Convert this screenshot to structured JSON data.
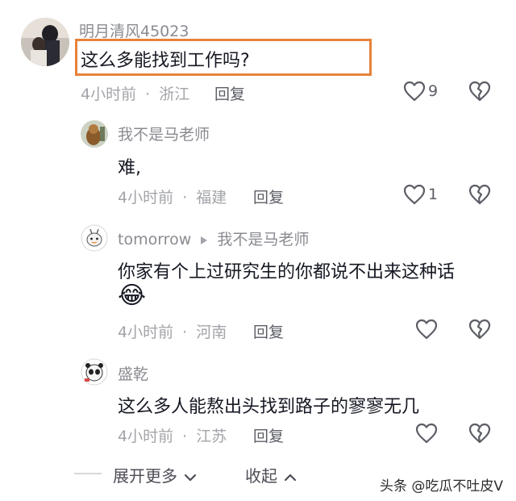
{
  "comments": [
    {
      "username": "明月清风45023",
      "text": "这么多能找到工作吗?",
      "time": "4小时前",
      "location": "浙江",
      "reply_label": "回复",
      "likes": "9",
      "highlighted": true
    },
    {
      "username": "我不是马老师",
      "text": "难,",
      "time": "4小时前",
      "location": "福建",
      "reply_label": "回复",
      "likes": "1"
    },
    {
      "username": "tomorrow",
      "reply_to": "我不是马老师",
      "text": "你家有个上过研究生的你都说不出来这种话",
      "emoji": "😂",
      "time": "4小时前",
      "location": "河南",
      "reply_label": "回复",
      "likes": ""
    },
    {
      "username": "盛乾",
      "text": "这么多人能熬出头找到路子的寥寥无几",
      "time": "4小时前",
      "location": "江苏",
      "reply_label": "回复",
      "likes": ""
    }
  ],
  "footer": {
    "expand_label": "展开更多",
    "collapse_label": "收起"
  },
  "watermark": "头条 @吃瓜不吐皮V",
  "separator": "·",
  "colors": {
    "highlight_border": "#e8823a",
    "text_primary": "#161823",
    "text_secondary": "#a3a4a9"
  },
  "icons": [
    "heart-outline-icon",
    "broken-heart-icon",
    "chevron-down-icon",
    "chevron-up-icon",
    "reply-arrow-icon"
  ]
}
